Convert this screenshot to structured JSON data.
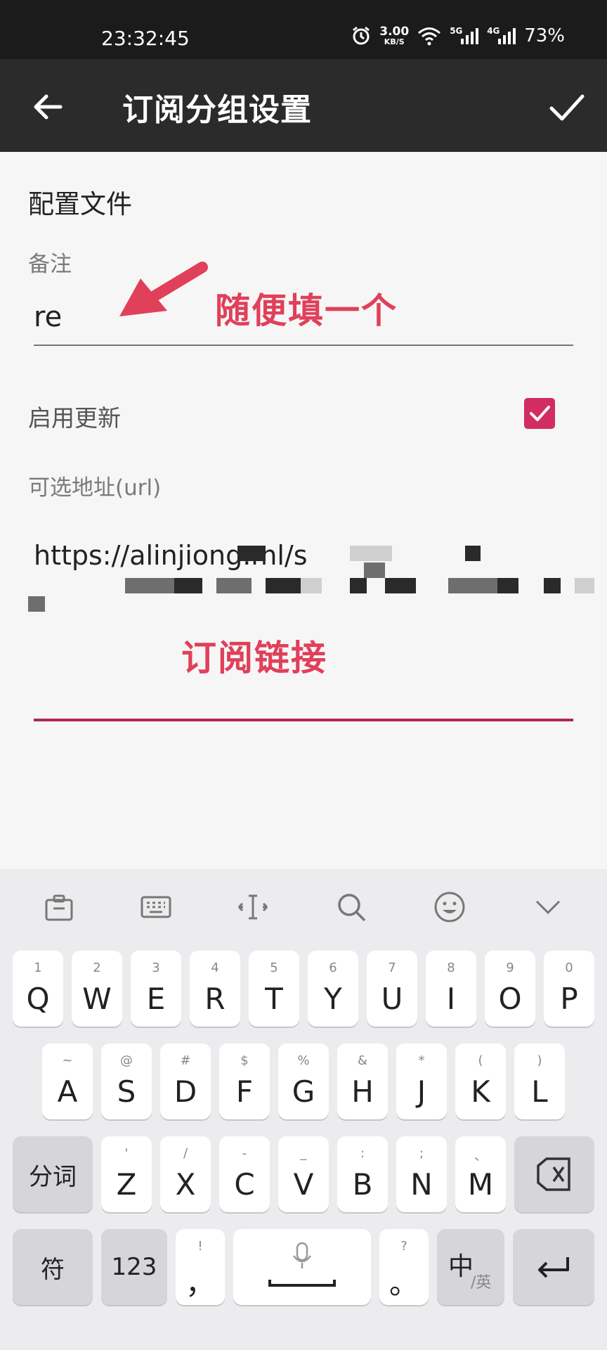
{
  "status_bar": {
    "time": "23:32:45",
    "net_speed": "3.00",
    "net_speed_unit": "KB/S",
    "sim1": "5G",
    "sim2": "4G",
    "battery": "73%"
  },
  "app_bar": {
    "title": "订阅分组设置",
    "back_icon": "arrow-back-icon",
    "confirm_icon": "check-icon"
  },
  "form": {
    "section_title": "配置文件",
    "remark_label": "备注",
    "remark_value": "re",
    "enable_update_label": "启用更新",
    "enable_update_checked": true,
    "url_label": "可选地址(url)",
    "url_value": "https://alinjiong.ml/s"
  },
  "annotations": {
    "remark_hint": "随便填一个",
    "url_hint": "订阅链接"
  },
  "colors": {
    "accent": "#d12d60",
    "annotation": "#e0405a",
    "app_bar": "#2b2b2b"
  },
  "keyboard": {
    "row1": [
      {
        "sub": "1",
        "main": "Q"
      },
      {
        "sub": "2",
        "main": "W"
      },
      {
        "sub": "3",
        "main": "E"
      },
      {
        "sub": "4",
        "main": "R"
      },
      {
        "sub": "5",
        "main": "T"
      },
      {
        "sub": "6",
        "main": "Y"
      },
      {
        "sub": "7",
        "main": "U"
      },
      {
        "sub": "8",
        "main": "I"
      },
      {
        "sub": "9",
        "main": "O"
      },
      {
        "sub": "0",
        "main": "P"
      }
    ],
    "row2": [
      {
        "sub": "~",
        "main": "A"
      },
      {
        "sub": "@",
        "main": "S"
      },
      {
        "sub": "#",
        "main": "D"
      },
      {
        "sub": "$",
        "main": "F"
      },
      {
        "sub": "%",
        "main": "G"
      },
      {
        "sub": "&",
        "main": "H"
      },
      {
        "sub": "*",
        "main": "J"
      },
      {
        "sub": "(",
        "main": "K"
      },
      {
        "sub": ")",
        "main": "L"
      }
    ],
    "row3": [
      {
        "sub": "'",
        "main": "Z"
      },
      {
        "sub": "/",
        "main": "X"
      },
      {
        "sub": "-",
        "main": "C"
      },
      {
        "sub": "_",
        "main": "V"
      },
      {
        "sub": ":",
        "main": "B"
      },
      {
        "sub": ";",
        "main": "N"
      },
      {
        "sub": "、",
        "main": "M"
      }
    ],
    "fenci": "分词",
    "fu": "符",
    "num": "123",
    "excl_sub": "!",
    "excl_main": "，",
    "q_sub": "?",
    "q_main": "。",
    "lang_main": "中",
    "lang_sub": "/英"
  }
}
